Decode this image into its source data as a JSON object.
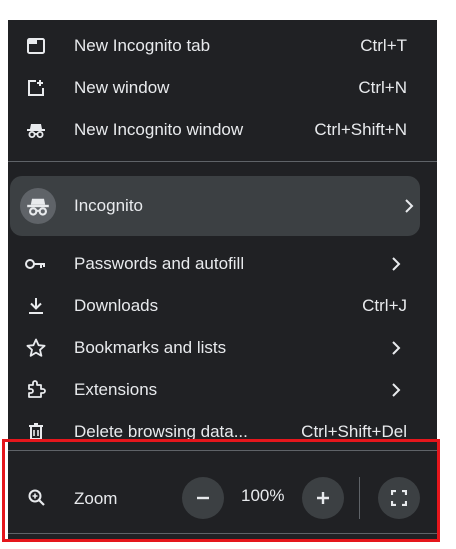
{
  "menu": {
    "items_top": [
      {
        "label": "New Incognito tab",
        "shortcut": "Ctrl+T",
        "icon": "new-tab-icon"
      },
      {
        "label": "New window",
        "shortcut": "Ctrl+N",
        "icon": "new-window-icon"
      },
      {
        "label": "New Incognito window",
        "shortcut": "Ctrl+Shift+N",
        "icon": "incognito-icon"
      }
    ],
    "profile": {
      "label": "Incognito",
      "icon": "incognito-icon"
    },
    "items_main": [
      {
        "label": "Passwords and autofill",
        "icon": "key-icon"
      },
      {
        "label": "Downloads",
        "shortcut": "Ctrl+J",
        "icon": "download-icon"
      },
      {
        "label": "Bookmarks and lists",
        "icon": "star-icon"
      },
      {
        "label": "Extensions",
        "icon": "extension-icon"
      },
      {
        "label": "Delete browsing data...",
        "shortcut": "Ctrl+Shift+Del",
        "icon": "trash-icon"
      }
    ],
    "zoom": {
      "label": "Zoom",
      "value": "100%",
      "icon": "zoom-icon"
    }
  },
  "colors": {
    "menu_bg": "#202124",
    "text": "#e8eaed",
    "highlight": "#e5161c"
  }
}
